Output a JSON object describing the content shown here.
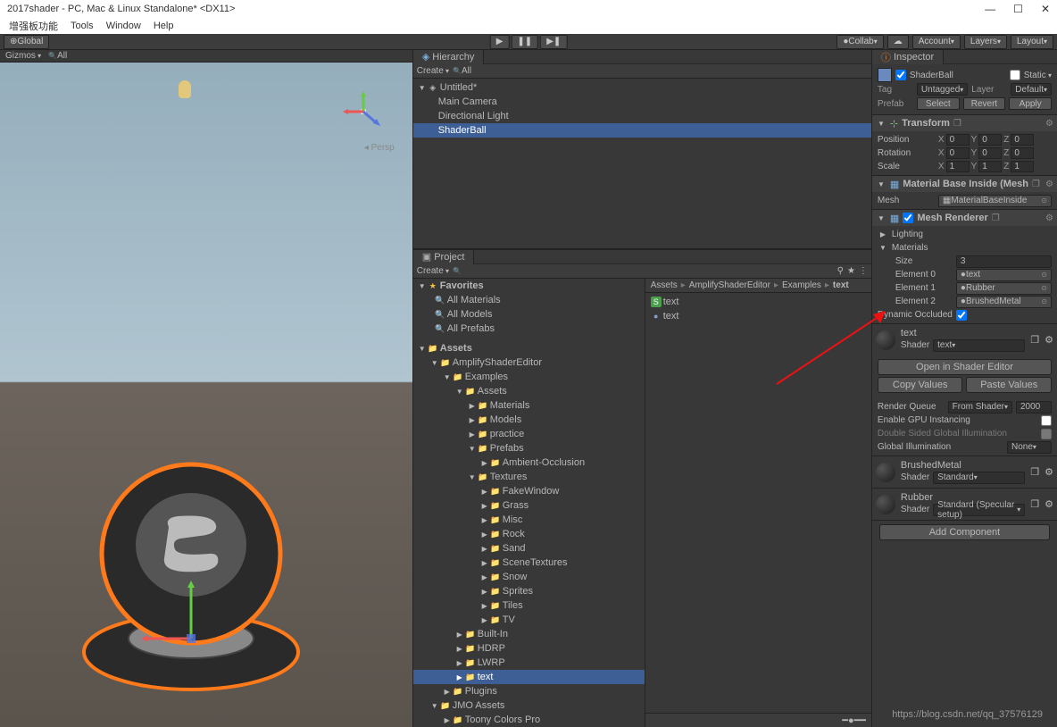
{
  "window": {
    "title": "2017shader - PC, Mac & Linux Standalone* <DX11>"
  },
  "menu": [
    "增强板功能",
    "Tools",
    "Window",
    "Help"
  ],
  "toolbar": {
    "global": "Global",
    "collab": "Collab",
    "account": "Account",
    "layers": "Layers",
    "layout": "Layout"
  },
  "scene": {
    "gizmos": "Gizmos",
    "all": "All",
    "persp": "Persp"
  },
  "hierarchy": {
    "title": "Hierarchy",
    "create": "Create",
    "all": "All",
    "scene": "Untitled*",
    "items": [
      "Main Camera",
      "Directional Light",
      "ShaderBall"
    ]
  },
  "project": {
    "title": "Project",
    "create": "Create",
    "favorites": "Favorites",
    "favs": [
      "All Materials",
      "All Models",
      "All Prefabs"
    ],
    "assets_root": "Assets",
    "tree": [
      {
        "n": "AmplifyShaderEditor",
        "d": 1,
        "o": true
      },
      {
        "n": "Examples",
        "d": 2,
        "o": true
      },
      {
        "n": "Assets",
        "d": 3,
        "o": true
      },
      {
        "n": "Materials",
        "d": 4,
        "o": false,
        "a": true
      },
      {
        "n": "Models",
        "d": 4,
        "o": false,
        "a": true
      },
      {
        "n": "practice",
        "d": 4,
        "o": false
      },
      {
        "n": "Prefabs",
        "d": 4,
        "o": true
      },
      {
        "n": "Ambient-Occlusion",
        "d": 5,
        "o": false
      },
      {
        "n": "Textures",
        "d": 4,
        "o": true
      },
      {
        "n": "FakeWindow",
        "d": 5,
        "o": false
      },
      {
        "n": "Grass",
        "d": 5,
        "o": false
      },
      {
        "n": "Misc",
        "d": 5,
        "o": false
      },
      {
        "n": "Rock",
        "d": 5,
        "o": false
      },
      {
        "n": "Sand",
        "d": 5,
        "o": false
      },
      {
        "n": "SceneTextures",
        "d": 5,
        "o": false
      },
      {
        "n": "Snow",
        "d": 5,
        "o": false
      },
      {
        "n": "Sprites",
        "d": 5,
        "o": false
      },
      {
        "n": "Tiles",
        "d": 5,
        "o": false
      },
      {
        "n": "TV",
        "d": 5,
        "o": false
      },
      {
        "n": "Built-In",
        "d": 3,
        "o": false,
        "a": true
      },
      {
        "n": "HDRP",
        "d": 3,
        "o": false,
        "a": true
      },
      {
        "n": "LWRP",
        "d": 3,
        "o": false,
        "a": true
      },
      {
        "n": "text",
        "d": 3,
        "o": false,
        "sel": true
      },
      {
        "n": "Plugins",
        "d": 2,
        "o": false,
        "a": true
      },
      {
        "n": "JMO Assets",
        "d": 1,
        "o": true
      },
      {
        "n": "Toony Colors Pro",
        "d": 2,
        "o": false,
        "a": true
      }
    ],
    "breadcrumb": [
      "Assets",
      "AmplifyShaderEditor",
      "Examples",
      "text"
    ],
    "files": [
      {
        "n": "text",
        "i": "S",
        "c": "#4aa04a"
      },
      {
        "n": "text",
        "i": "●",
        "c": "#7aa0d0"
      }
    ]
  },
  "inspector": {
    "title": "Inspector",
    "name": "ShaderBall",
    "static": "Static",
    "tag_label": "Tag",
    "tag": "Untagged",
    "layer_label": "Layer",
    "layer": "Default",
    "prefab": "Prefab",
    "select": "Select",
    "revert": "Revert",
    "apply": "Apply",
    "transform": {
      "title": "Transform",
      "position": "Position",
      "rotation": "Rotation",
      "scale": "Scale",
      "pos": [
        "0",
        "0",
        "0"
      ],
      "rot": [
        "0",
        "0",
        "0"
      ],
      "scl": [
        "1",
        "1",
        "1"
      ]
    },
    "mesh": {
      "title": "Material Base Inside (Mesh",
      "mesh_label": "Mesh",
      "mesh_val": "MaterialBaseInside"
    },
    "renderer": {
      "title": "Mesh Renderer",
      "lighting": "Lighting",
      "materials": "Materials",
      "size_label": "Size",
      "size": "3",
      "elements": [
        {
          "l": "Element 0",
          "v": "text"
        },
        {
          "l": "Element 1",
          "v": "Rubber"
        },
        {
          "l": "Element 2",
          "v": "BrushedMetal"
        }
      ],
      "dyn_occ": "Dynamic Occluded"
    },
    "mat_text": {
      "name": "text",
      "shader_label": "Shader",
      "shader": "text",
      "open": "Open in Shader Editor",
      "copy": "Copy Values",
      "paste": "Paste Values",
      "rq_label": "Render Queue",
      "rq_mode": "From Shader",
      "rq": "2000",
      "gpu": "Enable GPU Instancing",
      "dsgi": "Double Sided Global Illumination",
      "gi_label": "Global Illumination",
      "gi": "None"
    },
    "mat_brushed": {
      "name": "BrushedMetal",
      "shader_label": "Shader",
      "shader": "Standard"
    },
    "mat_rubber": {
      "name": "Rubber",
      "shader_label": "Shader",
      "shader": "Standard (Specular setup)"
    },
    "add_component": "Add Component"
  },
  "watermark": "https://blog.csdn.net/qq_37576129"
}
